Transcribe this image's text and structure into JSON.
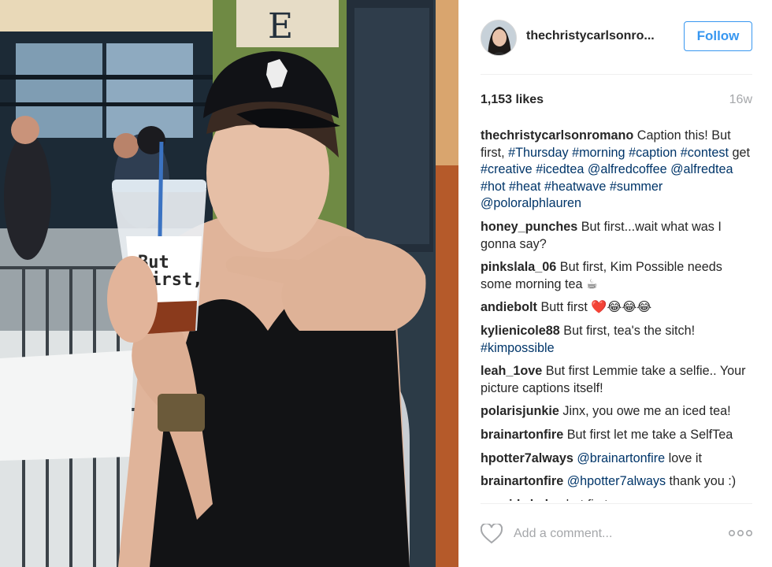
{
  "post": {
    "username": "thechristycarlsonro...",
    "follow_label": "Follow",
    "likes": "1,153 likes",
    "age": "16w"
  },
  "photo": {
    "cup_text_line1": "But",
    "cup_text_line2": "first,"
  },
  "comments": [
    {
      "user": "thechristycarlsonromano",
      "parts": [
        {
          "t": "text",
          "v": " Caption this! But first, "
        },
        {
          "t": "tag",
          "v": "#Thursday"
        },
        {
          "t": "text",
          "v": " "
        },
        {
          "t": "tag",
          "v": "#morning"
        },
        {
          "t": "text",
          "v": " "
        },
        {
          "t": "tag",
          "v": "#caption"
        },
        {
          "t": "text",
          "v": " "
        },
        {
          "t": "tag",
          "v": "#contest"
        },
        {
          "t": "text",
          "v": " get "
        },
        {
          "t": "tag",
          "v": "#creative"
        },
        {
          "t": "text",
          "v": " "
        },
        {
          "t": "tag",
          "v": "#icedtea"
        },
        {
          "t": "text",
          "v": " "
        },
        {
          "t": "tag",
          "v": "@alfredcoffee"
        },
        {
          "t": "text",
          "v": " "
        },
        {
          "t": "tag",
          "v": "@alfredtea"
        },
        {
          "t": "text",
          "v": " "
        },
        {
          "t": "tag",
          "v": "#hot"
        },
        {
          "t": "text",
          "v": " "
        },
        {
          "t": "tag",
          "v": "#heat"
        },
        {
          "t": "text",
          "v": " "
        },
        {
          "t": "tag",
          "v": "#heatwave"
        },
        {
          "t": "text",
          "v": " "
        },
        {
          "t": "tag",
          "v": "#summer"
        },
        {
          "t": "text",
          "v": " "
        },
        {
          "t": "tag",
          "v": "@poloralphlauren"
        }
      ]
    },
    {
      "user": "honey_punches",
      "parts": [
        {
          "t": "text",
          "v": " But first...wait what was I gonna say?"
        }
      ]
    },
    {
      "user": "pinkslala_06",
      "parts": [
        {
          "t": "text",
          "v": " But first, Kim Possible needs some morning tea ☕"
        }
      ]
    },
    {
      "user": "andiebolt",
      "parts": [
        {
          "t": "text",
          "v": " Butt first ❤️😂😂😂"
        }
      ]
    },
    {
      "user": "kylienicole88",
      "parts": [
        {
          "t": "text",
          "v": " But first, tea's the sitch! "
        },
        {
          "t": "tag",
          "v": "#kimpossible"
        }
      ]
    },
    {
      "user": "leah_1ove",
      "parts": [
        {
          "t": "text",
          "v": " But first Lemmie take a selfie.. Your picture captions itself!"
        }
      ]
    },
    {
      "user": "polarisjunkie",
      "parts": [
        {
          "t": "text",
          "v": " Jinx, you owe me an iced tea!"
        }
      ]
    },
    {
      "user": "brainartonfire",
      "parts": [
        {
          "t": "text",
          "v": " But first let me take a SelfTea"
        }
      ]
    },
    {
      "user": "hpotter7always",
      "parts": [
        {
          "t": "tag",
          "v": " @brainartonfire"
        },
        {
          "t": "text",
          "v": " love it"
        }
      ]
    },
    {
      "user": "brainartonfire",
      "parts": [
        {
          "t": "tag",
          "v": " @hpotter7always"
        },
        {
          "t": "text",
          "v": " thank you :)"
        }
      ]
    },
    {
      "user": "cassidy.haley",
      "parts": [
        {
          "t": "text",
          "v": " but first..."
        }
      ]
    }
  ],
  "footer": {
    "comment_placeholder": "Add a comment...",
    "like_icon": "heart-outline-icon",
    "more_icon": "more-options-icon"
  },
  "colors": {
    "accent": "#3897f0",
    "tag": "#003569",
    "muted": "#a5a7aa"
  }
}
